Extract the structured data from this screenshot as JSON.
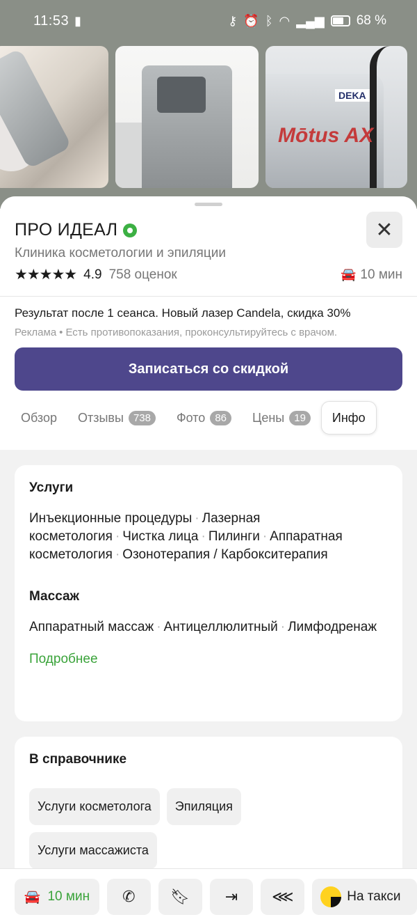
{
  "status_bar": {
    "time": "11:53",
    "battery": "68 %"
  },
  "photos": [
    {
      "label": ""
    },
    {
      "label": ""
    },
    {
      "brand_top": "DEKA",
      "brand_main": "Mōtus AX"
    }
  ],
  "place": {
    "name": "ПРО ИДЕАЛ",
    "category": "Клиника косметологии и эпиляции",
    "rating": "4.9",
    "reviews": "758 оценок",
    "drive_time": "10 мин",
    "stars": "★★★★★"
  },
  "ad": {
    "text": "Результат после 1 сеанса. Новый лазер Candela, скидка 30%",
    "label": "Реклама",
    "disclaimer": "Есть противопоказания, проконсультируйтесь с врачом."
  },
  "cta_label": "Записаться со скидкой",
  "tabs": [
    {
      "label": "Обзор",
      "count": ""
    },
    {
      "label": "Отзывы",
      "count": "738"
    },
    {
      "label": "Фото",
      "count": "86"
    },
    {
      "label": "Цены",
      "count": "19"
    },
    {
      "label": "Инфо",
      "count": ""
    }
  ],
  "services_card": {
    "title": "Услуги",
    "items": [
      "Инъекционные процедуры",
      "Лазерная косметология",
      "Чистка лица",
      "Пилинги",
      "Аппаратная косметология",
      "Озонотерапия / Карбокситерапия"
    ],
    "massage_title": "Массаж",
    "massage_items": [
      "Аппаратный массаж",
      "Антицеллюлитный",
      "Лимфодренаж"
    ],
    "more": "Подробнее"
  },
  "directory_card": {
    "title": "В справочнике",
    "chips": [
      "Услуги косметолога",
      "Эпиляция",
      "Услуги массажиста"
    ]
  },
  "bottom_bar": {
    "drive_label": "10 мин",
    "taxi_label": "На такси"
  },
  "icons": {
    "car": "car-icon",
    "phone": "phone-icon",
    "bookmark": "bookmark-icon",
    "route": "enter-icon",
    "share": "share-icon",
    "close": "close-icon"
  },
  "colors": {
    "accent": "#4e478c",
    "green": "#3aa33a",
    "verified": "#3cb043"
  }
}
